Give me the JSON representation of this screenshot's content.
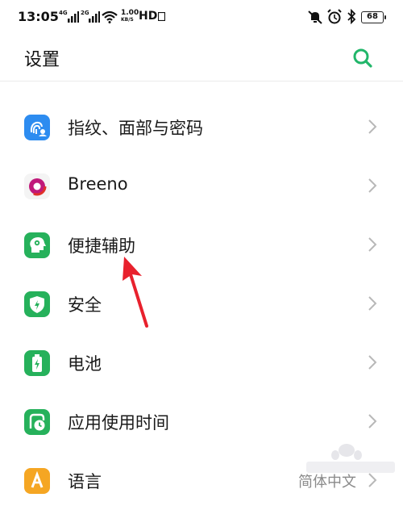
{
  "status_bar": {
    "time": "13:05",
    "network_4g": "4G",
    "network_2g": "2G",
    "speed_value": "1.00",
    "speed_unit": "KB/S",
    "hd": "HD",
    "battery": "68"
  },
  "header": {
    "title": "设置"
  },
  "settings": {
    "items": [
      {
        "label": "指纹、面部与密码",
        "icon": "fingerprint-face-icon",
        "color": "#2d8cf0"
      },
      {
        "label": "Breeno",
        "icon": "breeno-icon",
        "color": "#c0197a"
      },
      {
        "label": "便捷辅助",
        "icon": "convenience-assist-icon",
        "color": "#26b15b"
      },
      {
        "label": "安全",
        "icon": "security-shield-icon",
        "color": "#26b15b"
      },
      {
        "label": "电池",
        "icon": "battery-icon",
        "color": "#26b15b"
      },
      {
        "label": "应用使用时间",
        "icon": "app-usage-time-icon",
        "color": "#26b15b"
      },
      {
        "label": "语言",
        "value": "简体中文",
        "icon": "language-icon",
        "color": "#f5a623"
      }
    ]
  },
  "colors": {
    "accent": "#21b66a",
    "annotation_arrow": "#e8212d"
  }
}
